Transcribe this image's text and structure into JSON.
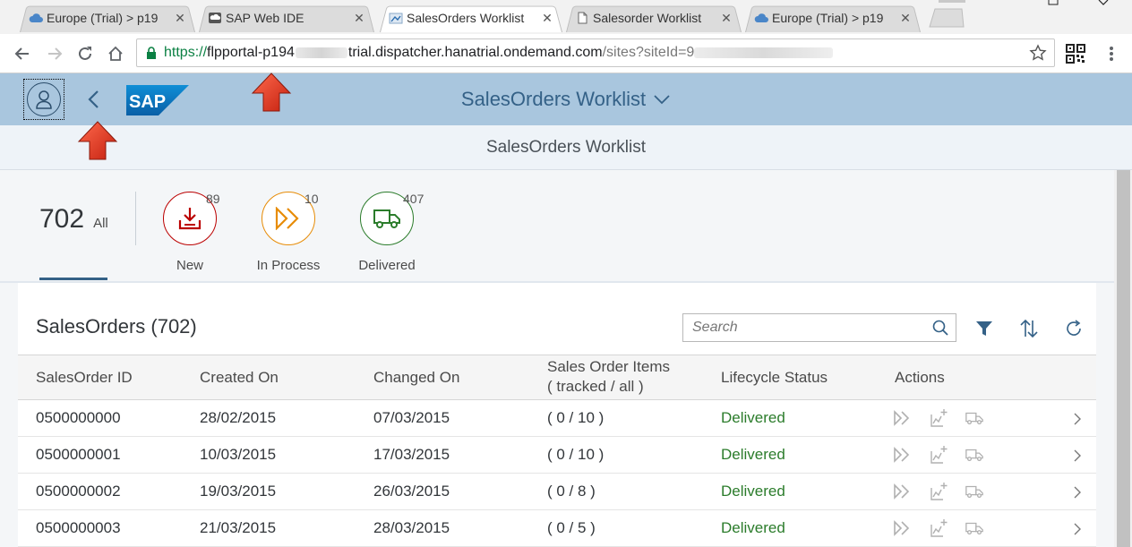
{
  "browser": {
    "tabs": [
      {
        "title": "Europe (Trial) > p19",
        "icon": "cloud-icon",
        "active": false
      },
      {
        "title": "SAP Web IDE",
        "icon": "webide-icon",
        "active": false
      },
      {
        "title": "SalesOrders Worklist",
        "icon": "fiori-icon",
        "active": true
      },
      {
        "title": "Salesorder Worklist",
        "icon": "document-icon",
        "active": false
      },
      {
        "title": "Europe (Trial) > p19",
        "icon": "cloud-icon",
        "active": false
      }
    ],
    "close_glyph": "✕",
    "url": {
      "scheme": "https://",
      "host_start": "flpportal-p194",
      "host_end": "trial.dispatcher.hanatrial.ondemand.com",
      "path": "/sites?siteId=9"
    }
  },
  "shell": {
    "title": "SalesOrders Worklist",
    "logo_text": "SAP"
  },
  "page": {
    "subheader_title": "SalesOrders Worklist"
  },
  "header": {
    "all_count": "702",
    "all_label": "All",
    "filters": [
      {
        "label": "New",
        "count": "89",
        "color": "#bb0000",
        "icon": "inbox-download-icon"
      },
      {
        "label": "In Process",
        "count": "10",
        "color": "#e78c07",
        "icon": "forward-icon"
      },
      {
        "label": "Delivered",
        "count": "407",
        "color": "#2b7c2b",
        "icon": "truck-icon"
      }
    ]
  },
  "table": {
    "title": "SalesOrders (702)",
    "search_placeholder": "Search",
    "columns": [
      "SalesOrder ID",
      "Created On",
      "Changed On",
      "Sales Order Items",
      "( tracked / all )",
      "Lifecycle Status",
      "Actions"
    ],
    "rows": [
      {
        "id": "0500000000",
        "created": "28/02/2015",
        "changed": "07/03/2015",
        "items": "( 0 / 10 )",
        "status": "Delivered"
      },
      {
        "id": "0500000001",
        "created": "10/03/2015",
        "changed": "17/03/2015",
        "items": "( 0 / 10 )",
        "status": "Delivered"
      },
      {
        "id": "0500000002",
        "created": "19/03/2015",
        "changed": "26/03/2015",
        "items": "( 0 / 8 )",
        "status": "Delivered"
      },
      {
        "id": "0500000003",
        "created": "21/03/2015",
        "changed": "28/03/2015",
        "items": "( 0 / 5 )",
        "status": "Delivered"
      }
    ]
  },
  "colors": {
    "shell_bg": "#a9c6de",
    "shell_text": "#346187",
    "status_positive": "#2b7c2b",
    "annotation_red": "#e0301e"
  }
}
